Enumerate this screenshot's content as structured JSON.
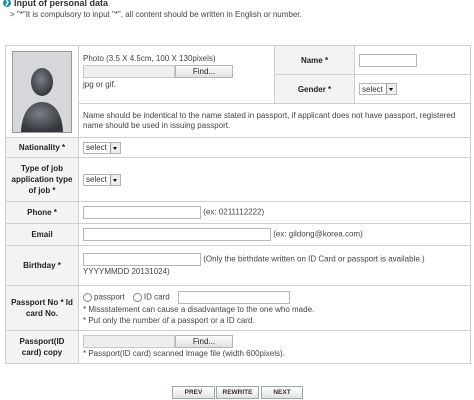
{
  "header": {
    "title": "Input of personal data",
    "note": "\"*\"It is compulsory to input \"*\", all content should be written in English or number."
  },
  "photo": {
    "spec": "Photo (3.5 X 4.5cm, 100 X 130pixels)",
    "find_label": "Find...",
    "formats": "jpg or gif."
  },
  "name": {
    "label": "Name *",
    "value": ""
  },
  "gender": {
    "label": "Gender *",
    "selected": "select"
  },
  "name_note": "Name should be indentical to the name stated in passport, if applicant does not have passport, registered name should be used in issuing passport.",
  "nationality": {
    "label": "Nationality *",
    "selected": "select"
  },
  "job": {
    "label": "Type of job application type of job *",
    "selected": "select"
  },
  "phone": {
    "label": "Phone *",
    "value": "",
    "hint": "(ex: 0211112222)"
  },
  "email": {
    "label": "Email",
    "value": "",
    "hint": "(ex: gildong@korea.com)"
  },
  "birthday": {
    "label": "Birthday *",
    "value": "",
    "hint": "(Only the birthdate written on ID Card or passport is available.)",
    "format": "YYYYMMDD 20131024)"
  },
  "passport_no": {
    "label": "Passport No * Id card No.",
    "options": [
      "passport",
      "ID card"
    ],
    "value": "",
    "note1": "* Missstatement can cause a disadvantage to the one who made.",
    "note2": "* Put only the number of a passport or a ID card."
  },
  "passport_copy": {
    "label": "Passport(ID card) copy",
    "find_label": "Find...",
    "note": "* Passport(ID card) scanned Image file (width 600pixels)."
  },
  "buttons": {
    "prev": "PREV",
    "rewrite": "REWRITE",
    "next": "NEXT"
  }
}
